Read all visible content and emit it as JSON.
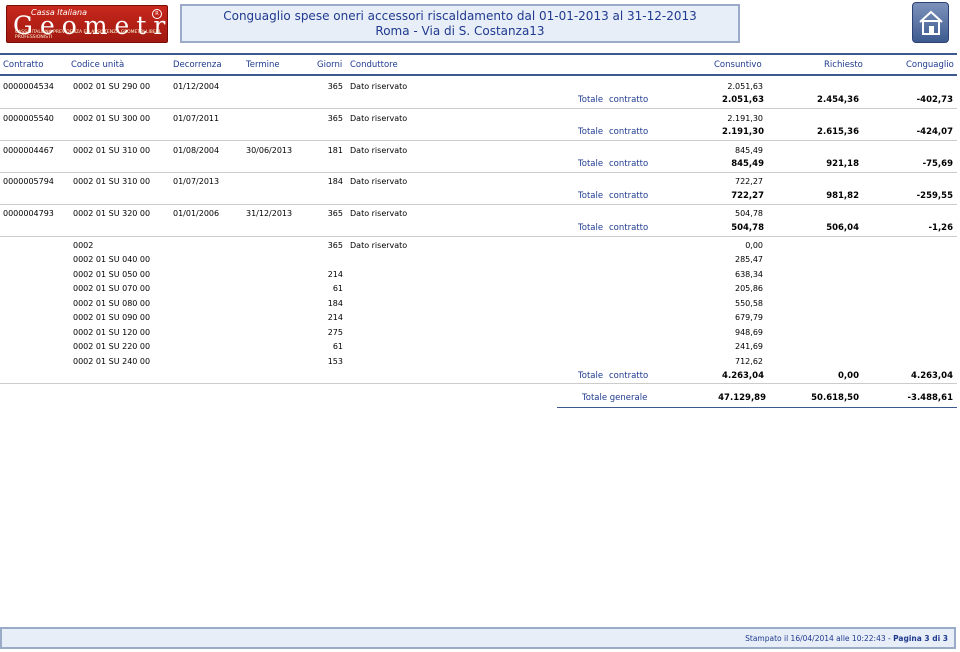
{
  "logo": {
    "line1": "Cassa Italiana",
    "line2": "Geometri",
    "line3": "CASSA ITALIANA PREVIDENZA ED ASSISTENZA GEOMETRI LIBERI PROFESSIONISTI",
    "reg": "R"
  },
  "title": {
    "line1": "Conguaglio spese oneri accessori riscaldamento dal 01-01-2013 al 31-12-2013",
    "line2": "Roma - Via di S. Costanza13"
  },
  "columns": {
    "contratto": "Contratto",
    "codice": "Codice unità",
    "decorrenza": "Decorrenza",
    "termine": "Termine",
    "giorni": "Giorni",
    "conduttore": "Conduttore",
    "consuntivo": "Consuntivo",
    "richiesto": "Richiesto",
    "conguaglio": "Conguaglio"
  },
  "totale_label": "Totale",
  "contratto_label": "contratto",
  "generale_label": "Totale generale",
  "rows": [
    {
      "contratto": "0000004534",
      "codice": "0002 01 SU 290 00",
      "decorrenza": "01/12/2004",
      "termine": "",
      "giorni": "365",
      "conduttore": "Dato riservato",
      "consuntivo": "2.051,63"
    },
    {
      "contratto": "0000005540",
      "codice": "0002 01 SU 300 00",
      "decorrenza": "01/07/2011",
      "termine": "",
      "giorni": "365",
      "conduttore": "Dato riservato",
      "consuntivo": "2.191,30"
    },
    {
      "contratto": "0000004467",
      "codice": "0002 01 SU 310 00",
      "decorrenza": "01/08/2004",
      "termine": "30/06/2013",
      "giorni": "181",
      "conduttore": "Dato riservato",
      "consuntivo": "845,49"
    },
    {
      "contratto": "0000005794",
      "codice": "0002 01 SU 310 00",
      "decorrenza": "01/07/2013",
      "termine": "",
      "giorni": "184",
      "conduttore": "Dato riservato",
      "consuntivo": "722,27"
    },
    {
      "contratto": "0000004793",
      "codice": "0002 01 SU 320 00",
      "decorrenza": "01/01/2006",
      "termine": "31/12/2013",
      "giorni": "365",
      "conduttore": "Dato riservato",
      "consuntivo": "504,78"
    },
    {
      "contratto": "",
      "codice": "0002",
      "decorrenza": "",
      "termine": "",
      "giorni": "365",
      "conduttore": "Dato riservato",
      "consuntivo": "0,00"
    },
    {
      "contratto": "",
      "codice": "0002 01 SU 040 00",
      "decorrenza": "",
      "termine": "",
      "giorni": "",
      "conduttore": "",
      "consuntivo": "285,47"
    },
    {
      "contratto": "",
      "codice": "0002 01 SU 050 00",
      "decorrenza": "",
      "termine": "",
      "giorni": "214",
      "conduttore": "",
      "consuntivo": "638,34"
    },
    {
      "contratto": "",
      "codice": "0002 01 SU 070 00",
      "decorrenza": "",
      "termine": "",
      "giorni": "61",
      "conduttore": "",
      "consuntivo": "205,86"
    },
    {
      "contratto": "",
      "codice": "0002 01 SU 080 00",
      "decorrenza": "",
      "termine": "",
      "giorni": "184",
      "conduttore": "",
      "consuntivo": "550,58"
    },
    {
      "contratto": "",
      "codice": "0002 01 SU 090 00",
      "decorrenza": "",
      "termine": "",
      "giorni": "214",
      "conduttore": "",
      "consuntivo": "679,79"
    },
    {
      "contratto": "",
      "codice": "0002 01 SU 120 00",
      "decorrenza": "",
      "termine": "",
      "giorni": "275",
      "conduttore": "",
      "consuntivo": "948,69"
    },
    {
      "contratto": "",
      "codice": "0002 01 SU 220 00",
      "decorrenza": "",
      "termine": "",
      "giorni": "61",
      "conduttore": "",
      "consuntivo": "241,69"
    },
    {
      "contratto": "",
      "codice": "0002 01 SU 240 00",
      "decorrenza": "",
      "termine": "",
      "giorni": "153",
      "conduttore": "",
      "consuntivo": "712,62"
    }
  ],
  "totals": [
    {
      "consuntivo": "2.051,63",
      "richiesto": "2.454,36",
      "conguaglio": "-402,73"
    },
    {
      "consuntivo": "2.191,30",
      "richiesto": "2.615,36",
      "conguaglio": "-424,07"
    },
    {
      "consuntivo": "845,49",
      "richiesto": "921,18",
      "conguaglio": "-75,69"
    },
    {
      "consuntivo": "722,27",
      "richiesto": "981,82",
      "conguaglio": "-259,55"
    },
    {
      "consuntivo": "504,78",
      "richiesto": "506,04",
      "conguaglio": "-1,26"
    },
    {
      "consuntivo": "4.263,04",
      "richiesto": "0,00",
      "conguaglio": "4.263,04"
    }
  ],
  "grand_total": {
    "consuntivo": "47.129,89",
    "richiesto": "50.618,50",
    "conguaglio": "-3.488,61"
  },
  "footer": {
    "text": "Stampato il 16/04/2014 alle 10:22:43  -  ",
    "page": "Pagina 3 di 3"
  },
  "icons": {
    "home": "home-icon"
  },
  "colors": {
    "header_blue": "#1f3a8f",
    "border_blue": "#3d5a8f",
    "logo_red": "#c8281c",
    "title_bg": "#e8eef8"
  }
}
